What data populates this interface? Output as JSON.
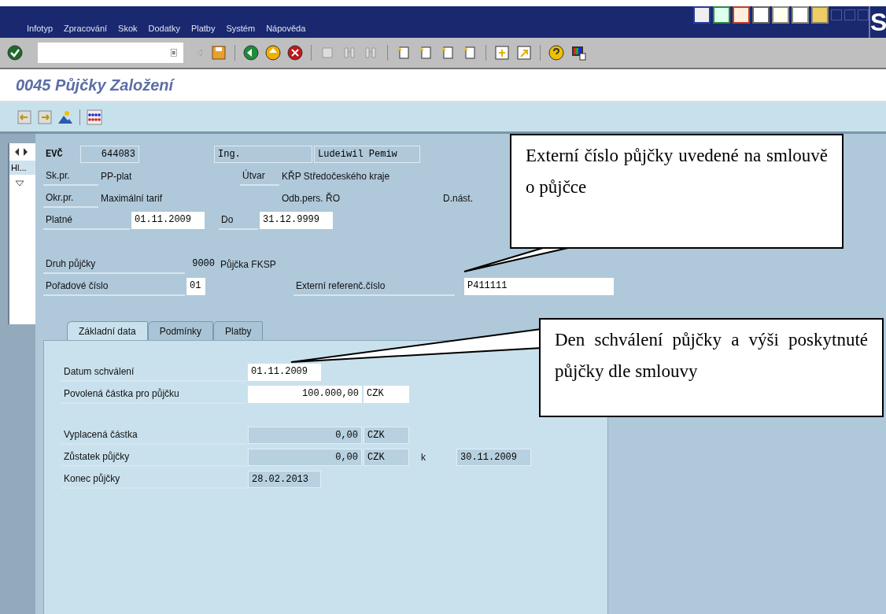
{
  "menu": [
    {
      "label": "Infotyp"
    },
    {
      "label": "Zpracování"
    },
    {
      "label": "Skok"
    },
    {
      "label": "Dodatky"
    },
    {
      "label": "Platby"
    },
    {
      "label": "Systém"
    },
    {
      "label": "Nápověda"
    }
  ],
  "logo_text": "S",
  "title": "0045 Půjčky Založení",
  "sidebar": {
    "tab_label": "Hl..."
  },
  "header": {
    "evc_label": "EVČ",
    "evc": "644083",
    "title_value": "Ing.",
    "name": "Ludeiwil Pemiw",
    "group_label": "Sk.pr.",
    "group": "PP-plat",
    "unit_label": "Útvar",
    "unit": "KŘP Středočeského kraje",
    "area_label": "Okr.pr.",
    "area": "Maximální tarif",
    "dept": "Odb.pers. ŘO",
    "entry_label": "D.nást.",
    "valid_label": "Platné",
    "valid_from": "01.11.2009",
    "to_label": "Do",
    "valid_to": "31.12.9999"
  },
  "loan": {
    "type_label": "Druh půjčky",
    "type_code": "9000",
    "type_name": "Půjčka FKSP",
    "seq_label": "Pořadové číslo",
    "seq": "01",
    "ext_label": "Externí referenč.číslo",
    "ext": "P411111"
  },
  "tabs": [
    {
      "label": "Základní data",
      "selected": true
    },
    {
      "label": "Podmínky",
      "selected": false
    },
    {
      "label": "Platby",
      "selected": false
    }
  ],
  "basic": {
    "approval_label": "Datum schválení",
    "approval": "01.11.2009",
    "amount_label": "Povolená částka pro půjčku",
    "amount": "100.000,00",
    "amount_cur": "CZK",
    "paid_label": "Vyplacená částka",
    "paid": "0,00",
    "paid_cur": "CZK",
    "balance_label": "Zůstatek půjčky",
    "balance": "0,00",
    "balance_cur": "CZK",
    "at_label": "k",
    "at": "30.11.2009",
    "end_label": "Konec půjčky",
    "end": "28.02.2013"
  },
  "callouts": [
    "Externí číslo půjčky uvedené na smlouvě o půjčce",
    "Den schválení půjčky a výši poskytnuté půjčky dle smlouvy"
  ]
}
